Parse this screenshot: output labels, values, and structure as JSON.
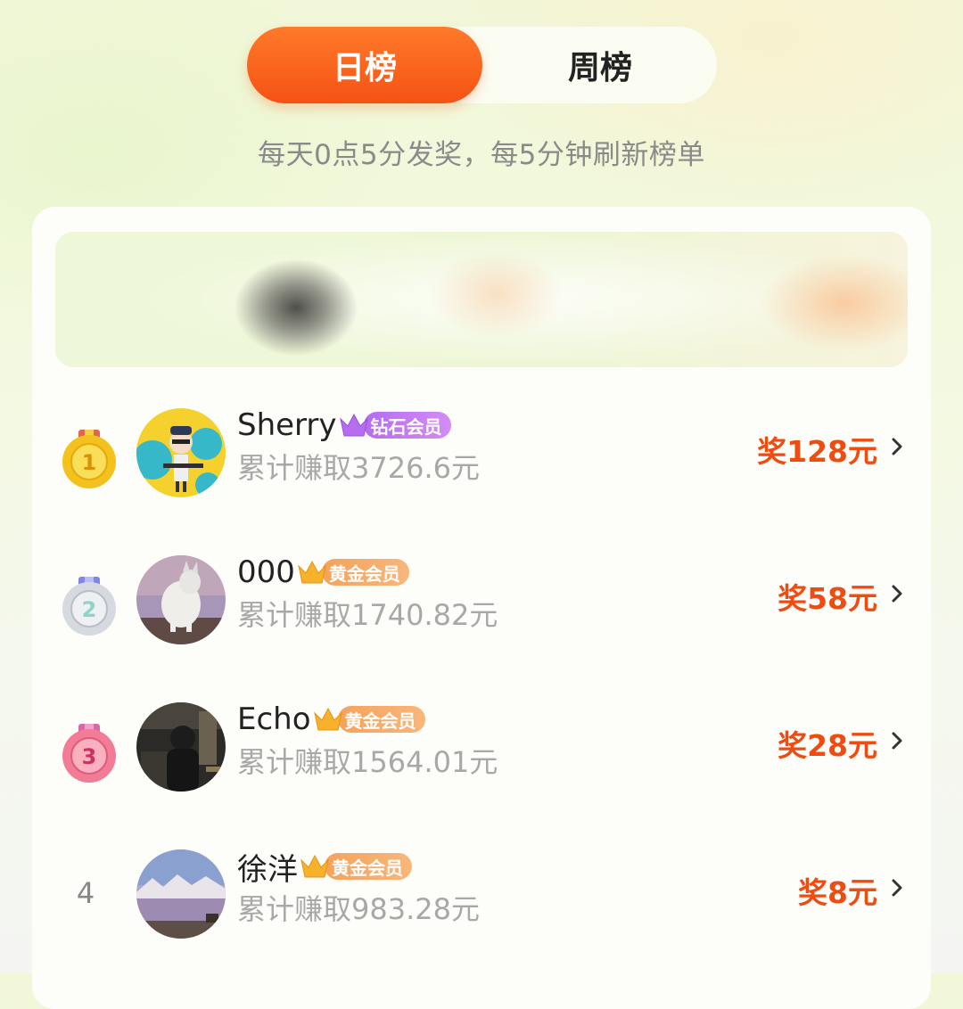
{
  "tabs": [
    {
      "label": "日榜",
      "active": true
    },
    {
      "label": "周榜",
      "active": false
    }
  ],
  "subtitle": "每天0点5分发奖，每5分钟刷新榜单",
  "colors": {
    "accent": "#f55214",
    "reward": "#ee4d12",
    "diamond_badge": "#c27cf3",
    "gold_badge": "#f6aa66"
  },
  "rankings": [
    {
      "rank": "1",
      "medal": "gold-medal-icon",
      "name": "Sherry",
      "badge": "钻石会员",
      "badge_type": "diamond",
      "earned": "累计赚取3726.6元",
      "reward": "奖128元",
      "avatar": "cartoon-girl-avatar"
    },
    {
      "rank": "2",
      "medal": "silver-medal-icon",
      "name": "000",
      "badge": "黄金会员",
      "badge_type": "gold",
      "earned": "累计赚取1740.82元",
      "reward": "奖58元",
      "avatar": "husky-dog-avatar"
    },
    {
      "rank": "3",
      "medal": "bronze-medal-icon",
      "name": "Echo",
      "badge": "黄金会员",
      "badge_type": "gold",
      "earned": "累计赚取1564.01元",
      "reward": "奖28元",
      "avatar": "dark-portrait-avatar"
    },
    {
      "rank": "4",
      "medal": "",
      "name": "徐洋",
      "badge": "黄金会员",
      "badge_type": "gold",
      "earned": "累计赚取983.28元",
      "reward": "奖8元",
      "avatar": "landscape-avatar"
    }
  ]
}
